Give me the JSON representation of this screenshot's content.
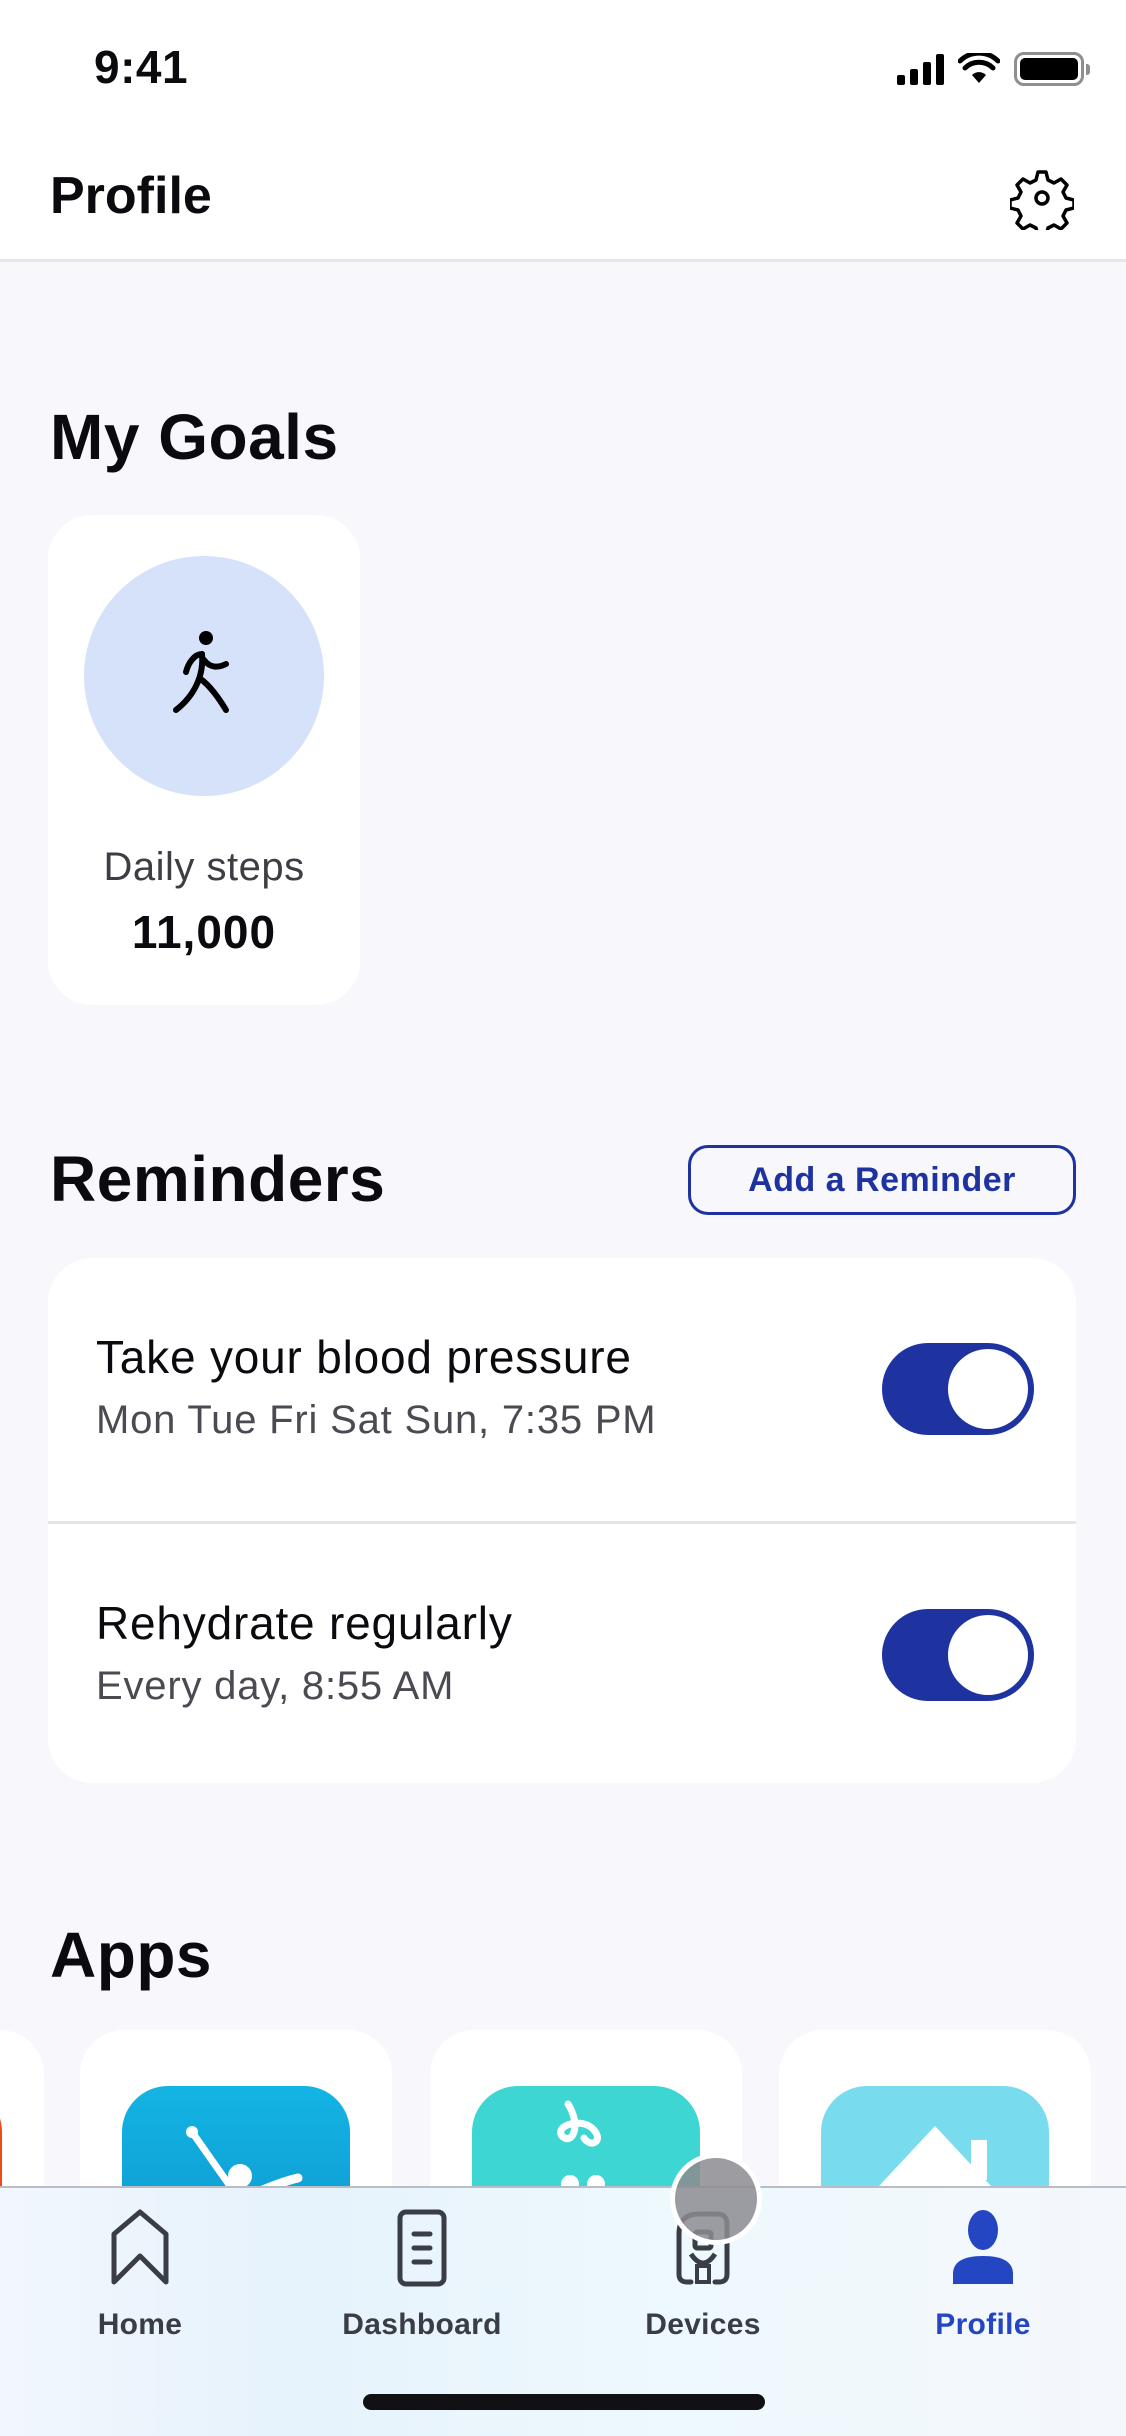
{
  "status_bar": {
    "time": "9:41",
    "icons": [
      "cellular-signal-icon",
      "wifi-icon",
      "battery-icon"
    ]
  },
  "header": {
    "title": "Profile",
    "settings_icon": "gear-icon"
  },
  "goals": {
    "title": "My Goals",
    "items": [
      {
        "icon": "walking-person-icon",
        "label": "Daily steps",
        "value": "11,000",
        "circle_color": "#d5e2fa"
      }
    ]
  },
  "reminders": {
    "title": "Reminders",
    "add_button_label": "Add a Reminder",
    "items": [
      {
        "title": "Take your blood pressure",
        "schedule": "Mon Tue Fri Sat Sun, 7:35 PM",
        "enabled": true
      },
      {
        "title": "Rehydrate regularly",
        "schedule": "Every day, 8:55 AM",
        "enabled": true
      }
    ]
  },
  "apps": {
    "title": "Apps",
    "items": [
      {
        "icon": "orange-app-icon",
        "color": "#f04a1c"
      },
      {
        "icon": "dancer-app-icon",
        "color": "#14a9e0"
      },
      {
        "icon": "runkeeper-app-icon",
        "color": "#3dd6d2"
      },
      {
        "icon": "home-app-icon",
        "color": "#79dcee"
      }
    ]
  },
  "tab_bar": {
    "tabs": [
      {
        "label": "Home",
        "icon": "home-icon",
        "active": false
      },
      {
        "label": "Dashboard",
        "icon": "dashboard-icon",
        "active": false
      },
      {
        "label": "Devices",
        "icon": "devices-icon",
        "active": false
      },
      {
        "label": "Profile",
        "icon": "profile-icon",
        "active": true
      }
    ]
  },
  "colors": {
    "accent": "#1e33a0",
    "active_tab": "#2446c2",
    "background": "#f7f7fc",
    "card": "#ffffff"
  }
}
